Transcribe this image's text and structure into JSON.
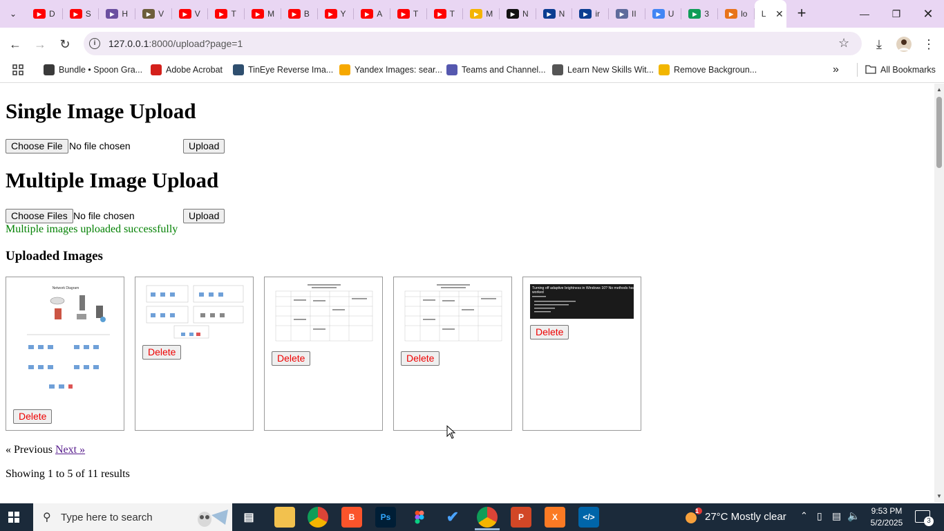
{
  "browser": {
    "tabs": [
      {
        "icon": "youtube-icon",
        "label": "D",
        "color": "#ff0000"
      },
      {
        "icon": "youtube-icon",
        "label": "S",
        "color": "#ff0000"
      },
      {
        "icon": "puzzle-icon",
        "label": "H",
        "color": "#6b4fa0"
      },
      {
        "icon": "site-icon",
        "label": "V",
        "color": "#6d5d3a"
      },
      {
        "icon": "youtube-icon",
        "label": "V",
        "color": "#ff0000"
      },
      {
        "icon": "youtube-icon",
        "label": "T",
        "color": "#ff0000"
      },
      {
        "icon": "youtube-icon",
        "label": "M",
        "color": "#ff0000"
      },
      {
        "icon": "youtube-icon",
        "label": "B",
        "color": "#ff0000"
      },
      {
        "icon": "youtube-icon",
        "label": "Y",
        "color": "#ff0000"
      },
      {
        "icon": "youtube-icon",
        "label": "A",
        "color": "#ff0000"
      },
      {
        "icon": "youtube-icon",
        "label": "T",
        "color": "#ff0000"
      },
      {
        "icon": "youtube-icon",
        "label": "T",
        "color": "#ff0000"
      },
      {
        "icon": "classroom-icon",
        "label": "M",
        "color": "#f4b400"
      },
      {
        "icon": "openai-icon",
        "label": "N",
        "color": "#111111"
      },
      {
        "icon": "nasa-icon",
        "label": "N",
        "color": "#0b3d91"
      },
      {
        "icon": "nasa-icon",
        "label": "ir",
        "color": "#0b3d91"
      },
      {
        "icon": "globe-icon",
        "label": "II",
        "color": "#5f6b9c"
      },
      {
        "icon": "google-icon",
        "label": "U",
        "color": "#4285f4"
      },
      {
        "icon": "sheets-icon",
        "label": "3",
        "color": "#0f9d58"
      },
      {
        "icon": "pma-icon",
        "label": "lo",
        "color": "#e8731b"
      }
    ],
    "active_tab": {
      "label": "L"
    },
    "url_host": "127.0.0.1",
    "url_rest": ":8000/upload?page=1",
    "bookmarks": [
      {
        "label": "Bundle • Spoon Gra...",
        "icon": "sg-icon",
        "color": "#3a3a3a"
      },
      {
        "label": "Adobe Acrobat",
        "icon": "acrobat-icon",
        "color": "#d4201b"
      },
      {
        "label": "TinEye Reverse Ima...",
        "icon": "tineye-icon",
        "color": "#2f4f6f"
      },
      {
        "label": "Yandex Images: sear...",
        "icon": "yandex-icon",
        "color": "#f6a800"
      },
      {
        "label": "Teams and Channel...",
        "icon": "teams-icon",
        "color": "#5558af"
      },
      {
        "label": "Learn New Skills Wit...",
        "icon": "learn-icon",
        "color": "#555555"
      },
      {
        "label": "Remove Backgroun...",
        "icon": "removebg-icon",
        "color": "#f2b600"
      }
    ],
    "all_bookmarks": "All Bookmarks"
  },
  "page": {
    "single_title": "Single Image Upload",
    "single_file_button": "Choose File",
    "single_file_status": "No file chosen",
    "single_upload_button": "Upload",
    "multi_title": "Multiple Image Upload",
    "multi_file_button": "Choose Files",
    "multi_file_status": "No file chosen",
    "multi_upload_button": "Upload",
    "success_message": "Multiple images uploaded successfully",
    "uploaded_title": "Uploaded Images",
    "images": [
      {
        "alt": "Network Diagram",
        "delete_label": "Delete"
      },
      {
        "alt": "network layout",
        "delete_label": "Delete"
      },
      {
        "alt": "timetable",
        "delete_label": "Delete"
      },
      {
        "alt": "timetable",
        "delete_label": "Delete"
      },
      {
        "alt": "Turning off adaptive brightness in Windows 10? No methods have worked",
        "delete_label": "Delete"
      }
    ],
    "prev_label": "« Previous",
    "next_label": "Next »",
    "results_text": "Showing 1 to 5 of 11 results"
  },
  "taskbar": {
    "search_placeholder": "Type here to search",
    "weather": "27°C  Mostly clear",
    "weather_badge": "1",
    "time": "9:53 PM",
    "date": "5/2/2025",
    "notifications": "3"
  }
}
